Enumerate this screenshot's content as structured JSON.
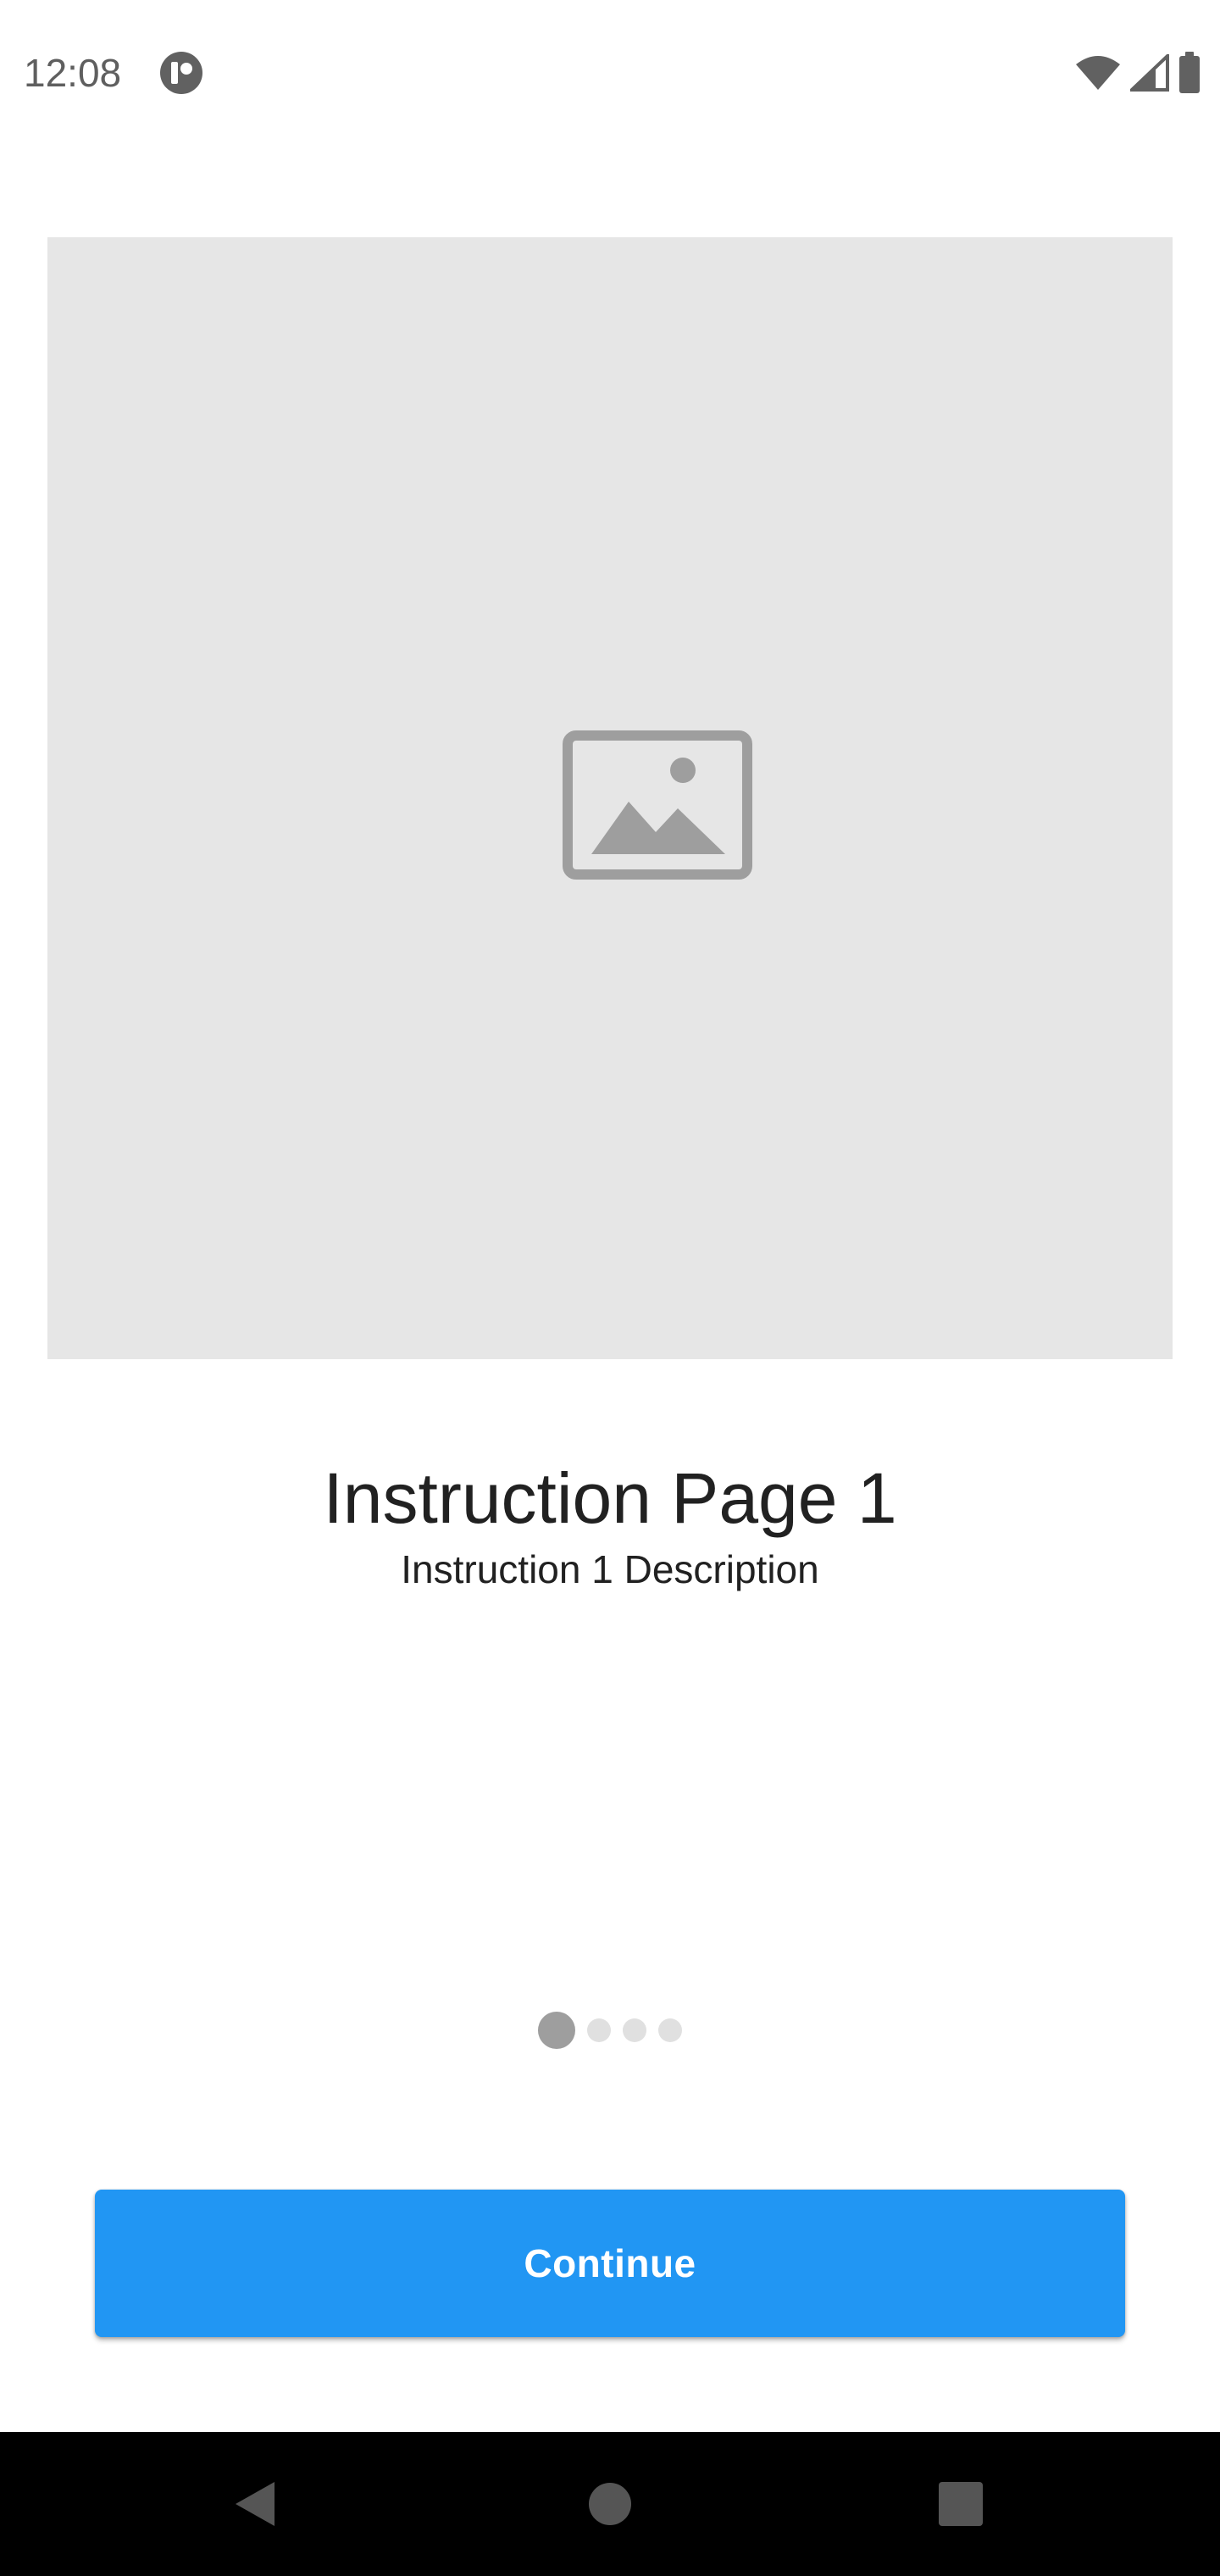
{
  "status_bar": {
    "time": "12:08",
    "icons": [
      "app-notification-icon",
      "wifi-icon",
      "cellular-signal-icon",
      "battery-icon"
    ]
  },
  "hero": {
    "icon": "image-placeholder-icon",
    "background_color": "#e6e6e6"
  },
  "content": {
    "title": "Instruction Page 1",
    "description": "Instruction 1 Description"
  },
  "pager": {
    "total_pages": 4,
    "current_page": 1
  },
  "actions": {
    "continue_label": "Continue",
    "accent_color": "#2196f3"
  },
  "nav_bar": {
    "buttons": [
      "back-icon",
      "home-icon",
      "recents-icon"
    ]
  }
}
